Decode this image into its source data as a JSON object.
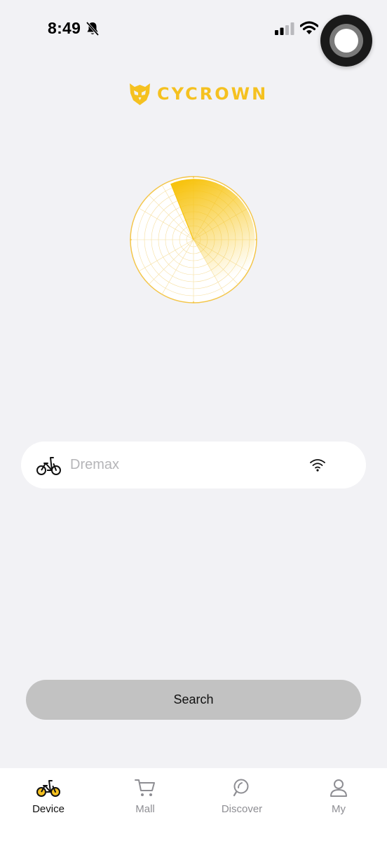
{
  "status_bar": {
    "time": "8:49",
    "icons": [
      "bell-slash-icon",
      "cellular-signal-icon",
      "wifi-icon",
      "assistive-touch-button"
    ]
  },
  "brand": {
    "name": "CYCROWN",
    "accent_color": "#f5c120"
  },
  "device": {
    "name": "Dremax",
    "type_icon": "bicycle-icon",
    "connection_icon": "wifi-icon"
  },
  "actions": {
    "search_label": "Search"
  },
  "tabs": [
    {
      "label": "Device",
      "icon": "bicycle-icon",
      "active": true
    },
    {
      "label": "Mall",
      "icon": "cart-icon",
      "active": false
    },
    {
      "label": "Discover",
      "icon": "compass-icon",
      "active": false
    },
    {
      "label": "My",
      "icon": "person-icon",
      "active": false
    }
  ]
}
